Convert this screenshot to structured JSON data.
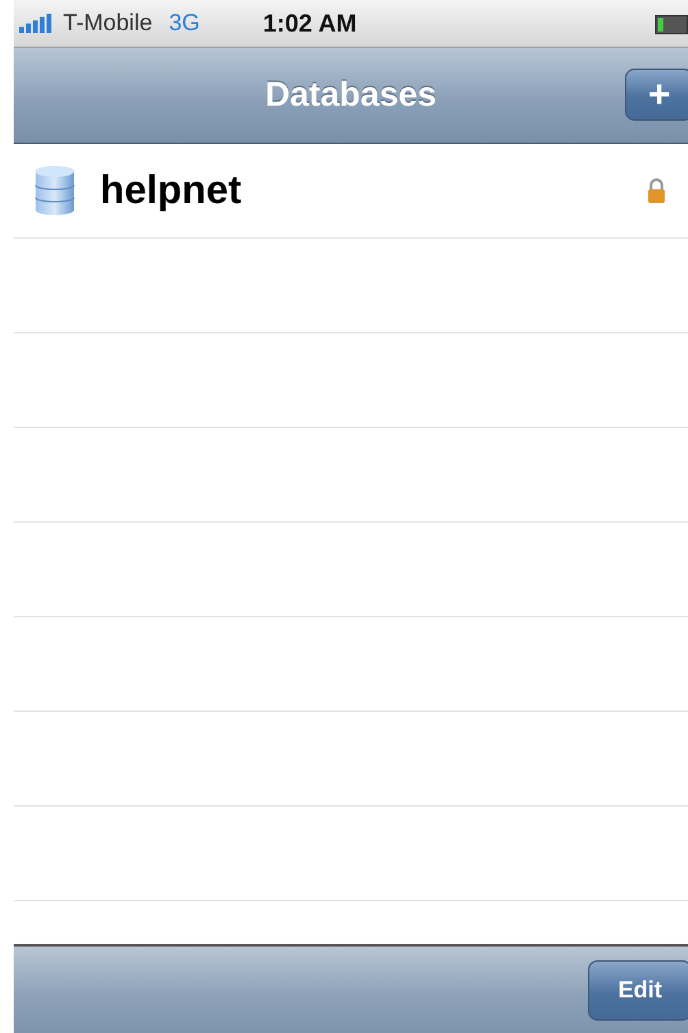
{
  "status_bar": {
    "carrier": "T-Mobile",
    "network": "3G",
    "time": "1:02 AM"
  },
  "nav_bar": {
    "title": "Databases",
    "add_button": "+"
  },
  "databases": [
    {
      "name": "helpnet",
      "locked": true
    }
  ],
  "toolbar": {
    "edit_button": "Edit"
  }
}
